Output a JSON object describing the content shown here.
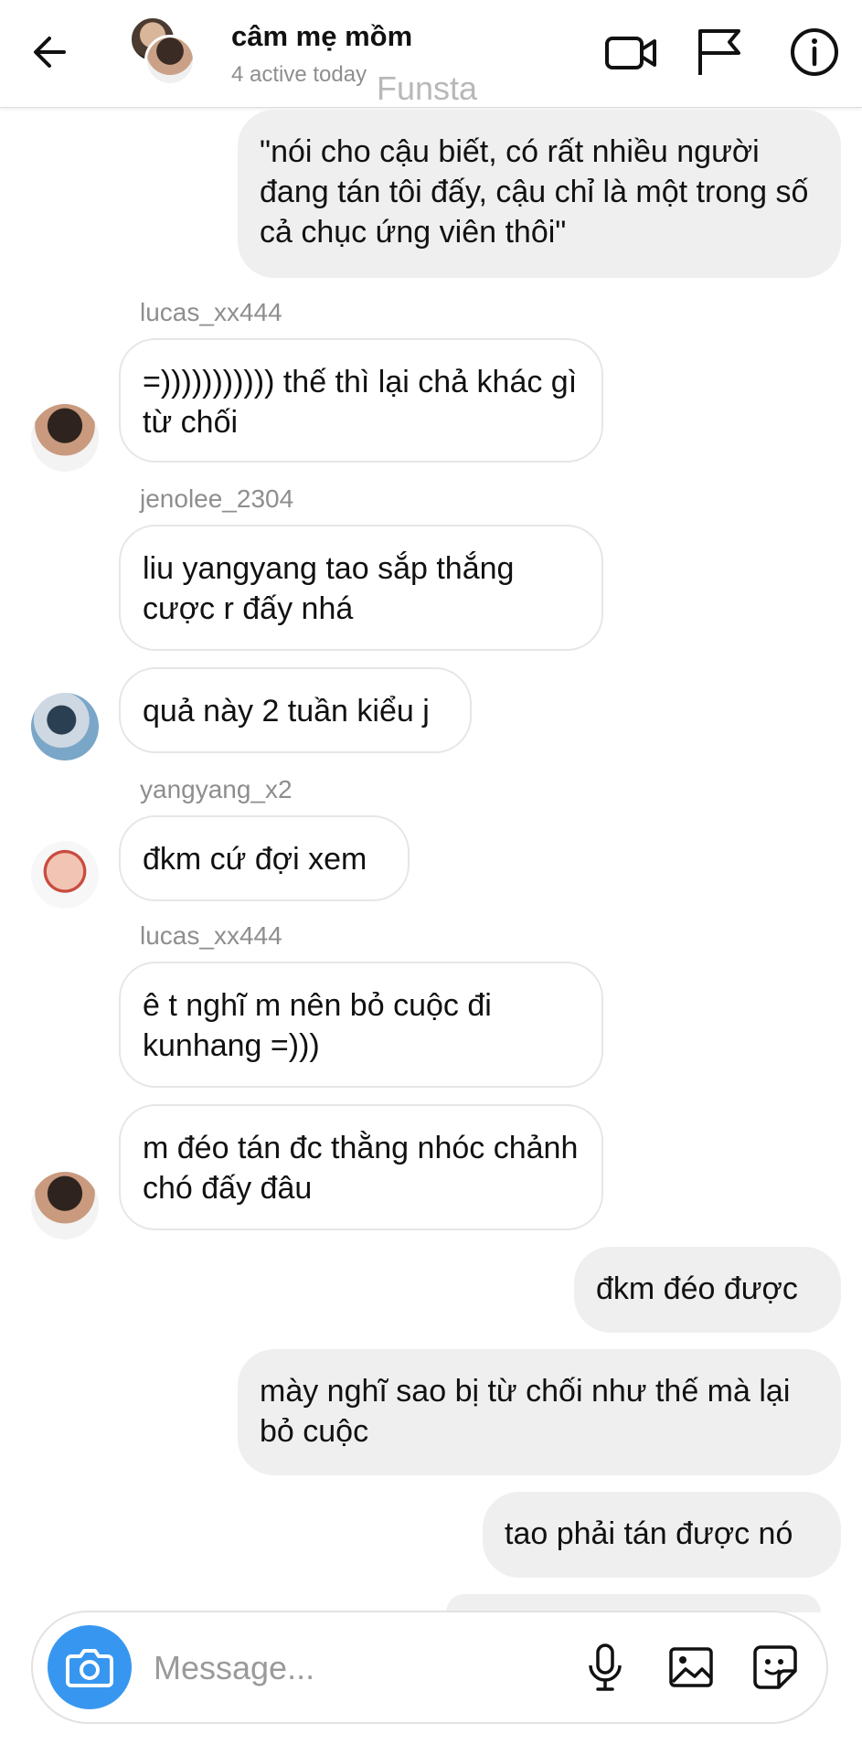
{
  "header": {
    "title": "câm mẹ mồm",
    "subtitle": "4 active today",
    "watermark": "Funsta"
  },
  "icons": {
    "back": "back-arrow-icon",
    "video": "video-camera-icon",
    "flag": "flag-icon",
    "info": "info-icon",
    "camera": "camera-icon",
    "mic": "microphone-icon",
    "gallery": "gallery-icon",
    "sticker": "sticker-icon"
  },
  "messages": [
    {
      "id": "m1",
      "direction": "out",
      "text": "\"nói cho cậu biết, có rất nhiều người đang tán tôi đấy, cậu chỉ là một trong số cả chục ứng viên thôi\""
    },
    {
      "id": "m2",
      "direction": "in",
      "sender": "lucas_xx444",
      "text": "=))))))))))) thế thì lại chả khác gì từ chối"
    },
    {
      "id": "m3",
      "direction": "in",
      "sender": "jenolee_2304",
      "text": "liu yangyang tao sắp thắng cược r đấy nhá"
    },
    {
      "id": "m4",
      "direction": "in",
      "text": "quả này 2 tuần kiểu j"
    },
    {
      "id": "m5",
      "direction": "in",
      "sender": "yangyang_x2",
      "text": "đkm cứ đợi xem"
    },
    {
      "id": "m6",
      "direction": "in",
      "sender": "lucas_xx444",
      "text": "ê t nghĩ m nên bỏ cuộc đi kunhang =)))"
    },
    {
      "id": "m7",
      "direction": "in",
      "text": "m đéo tán đc thằng nhóc chảnh chó đấy đâu"
    },
    {
      "id": "m8",
      "direction": "out",
      "text": "đkm đéo được"
    },
    {
      "id": "m9",
      "direction": "out",
      "text": "mày nghĩ sao bị từ chối như thế mà lại bỏ cuộc"
    },
    {
      "id": "m10",
      "direction": "out",
      "text": "tao phải tán được nó"
    }
  ],
  "composer": {
    "placeholder": "Message...",
    "accent_color": "#3797f0"
  }
}
